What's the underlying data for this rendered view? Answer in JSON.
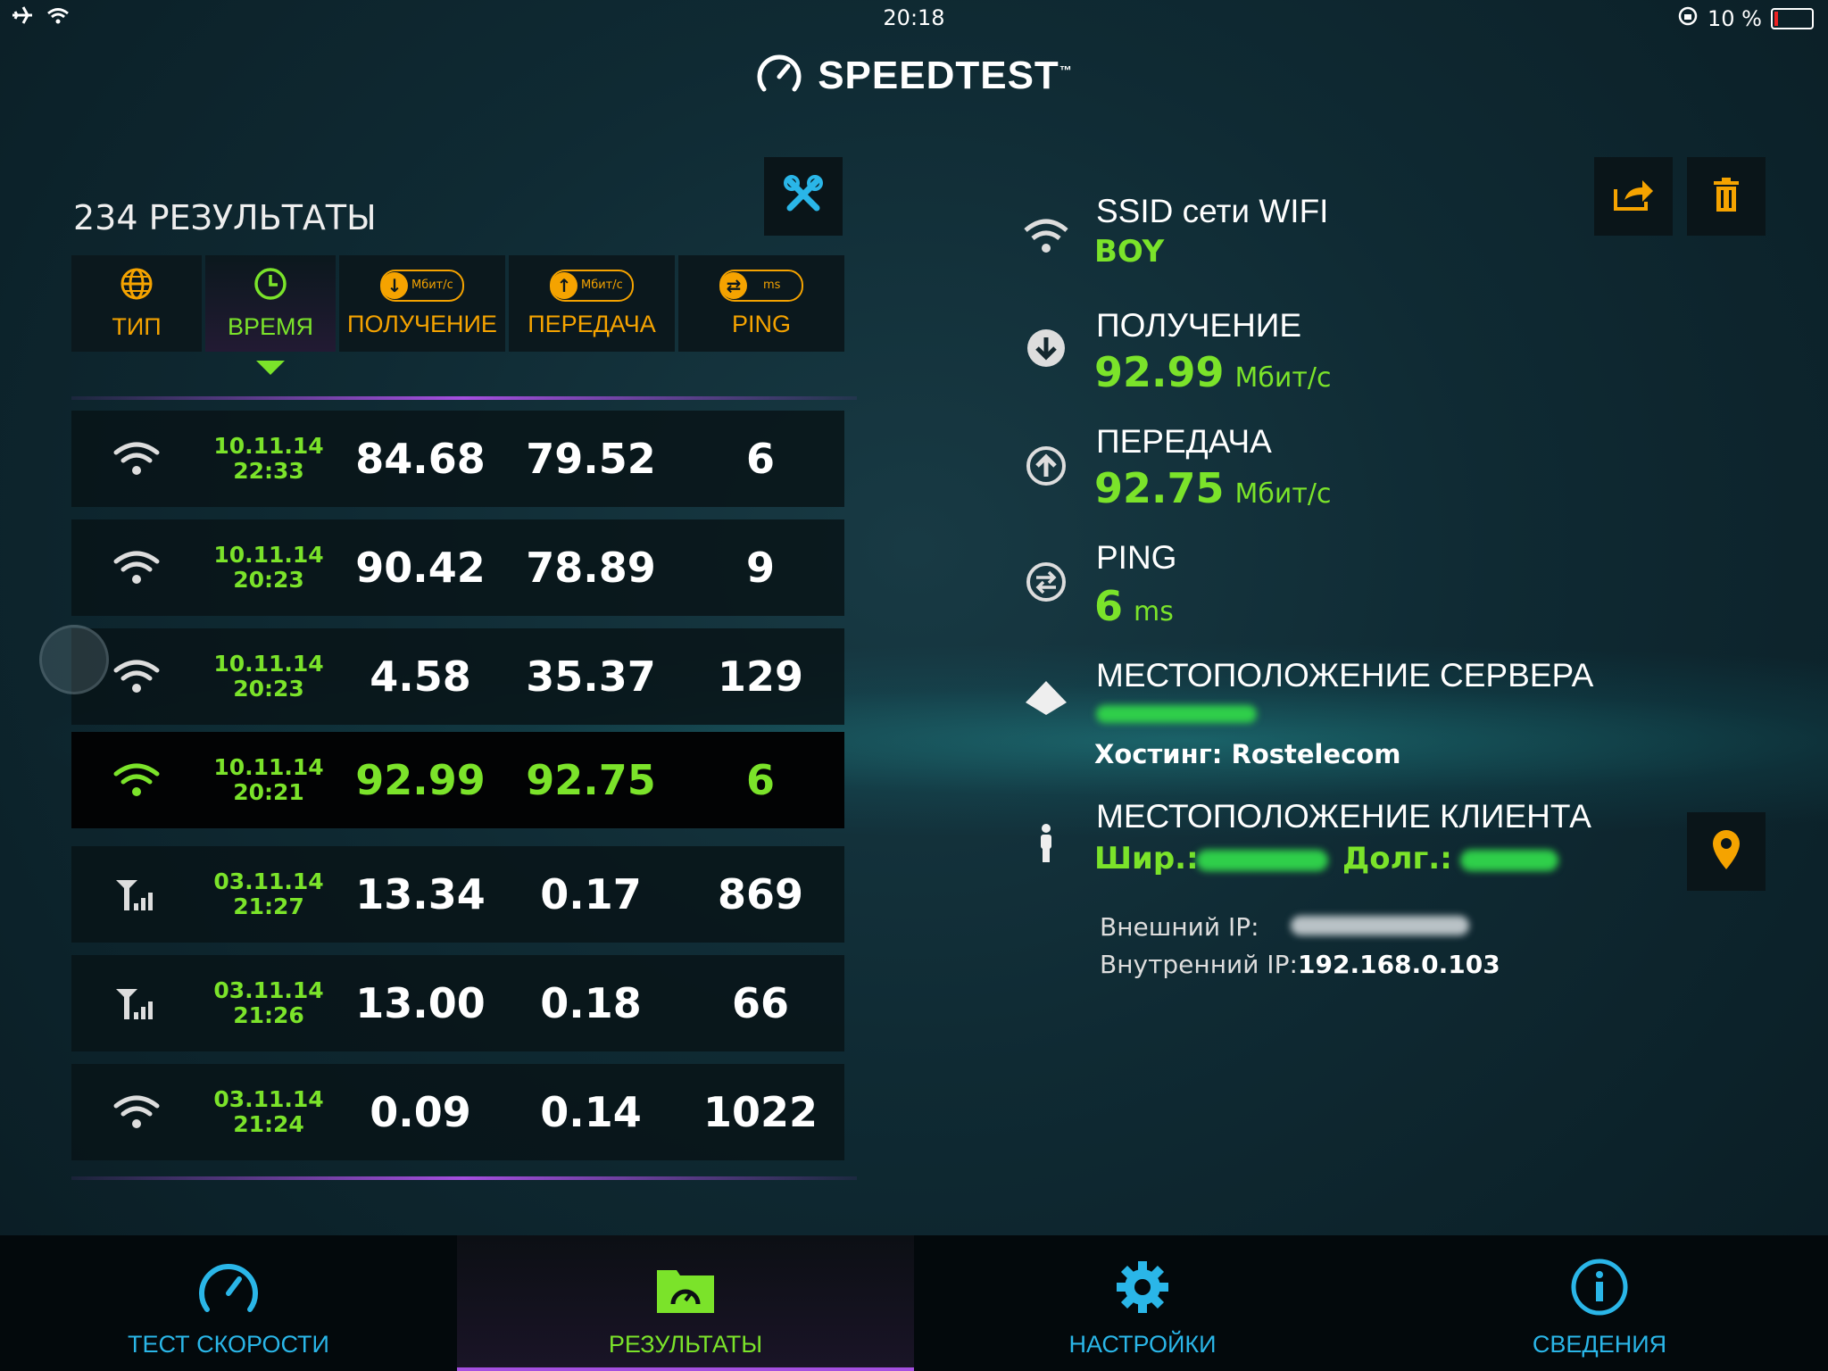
{
  "status_bar": {
    "time": "20:18",
    "battery": "10 %",
    "battery_level": 0.1
  },
  "app": {
    "title": "SPEEDTEST",
    "trademark": "™"
  },
  "results": {
    "count_title": "234 РЕЗУЛЬТАТЫ",
    "columns": [
      {
        "label": "ТИП",
        "icon": "globe-icon"
      },
      {
        "label": "ВРЕМЯ",
        "icon": "clock-icon"
      },
      {
        "label": "ПОЛУЧЕНИЕ",
        "icon": "download-icon",
        "unit": "Мбит/с"
      },
      {
        "label": "ПЕРЕДАЧА",
        "icon": "upload-icon",
        "unit": "Мбит/с"
      },
      {
        "label": "PING",
        "icon": "ping-icon",
        "unit": "ms"
      }
    ],
    "rows": [
      {
        "type": "wifi",
        "date": "10.11.14",
        "time": "22:33",
        "download": "84.68",
        "upload": "79.52",
        "ping": "6"
      },
      {
        "type": "wifi",
        "date": "10.11.14",
        "time": "20:23",
        "download": "90.42",
        "upload": "78.89",
        "ping": "9"
      },
      {
        "type": "wifi",
        "date": "10.11.14",
        "time": "20:23",
        "download": "4.58",
        "upload": "35.37",
        "ping": "129"
      },
      {
        "type": "wifi",
        "date": "10.11.14",
        "time": "20:21",
        "download": "92.99",
        "upload": "92.75",
        "ping": "6"
      },
      {
        "type": "cellular",
        "date": "03.11.14",
        "time": "21:27",
        "download": "13.34",
        "upload": "0.17",
        "ping": "869"
      },
      {
        "type": "cellular",
        "date": "03.11.14",
        "time": "21:26",
        "download": "13.00",
        "upload": "0.18",
        "ping": "66"
      },
      {
        "type": "wifi",
        "date": "03.11.14",
        "time": "21:24",
        "download": "0.09",
        "upload": "0.14",
        "ping": "1022"
      }
    ]
  },
  "detail": {
    "ssid_label": "SSID сети WIFI",
    "ssid_value": "BOY",
    "download_label": "ПОЛУЧЕНИЕ",
    "download_value": "92.99",
    "download_unit": "Мбит/с",
    "upload_label": "ПЕРЕДАЧА",
    "upload_value": "92.75",
    "upload_unit": "Мбит/с",
    "ping_label": "PING",
    "ping_value": "6",
    "ping_unit": "ms",
    "server_label": "МЕСТОПОЛОЖЕНИЕ СЕРВЕРА",
    "hosting_label": "Хостинг:",
    "hosting_value": "Rostelecom",
    "client_label": "МЕСТОПОЛОЖЕНИЕ КЛИЕНТА",
    "lat_label": "Шир.:",
    "lon_label": "Долг.:",
    "external_ip_label": "Внешний IP:",
    "internal_ip_label": "Внутренний IP:",
    "internal_ip_value": "192.168.0.103"
  },
  "tabs": [
    {
      "label": "ТЕСТ СКОРОСТИ",
      "icon": "speedometer-icon"
    },
    {
      "label": "РЕЗУЛЬТАТЫ",
      "icon": "results-folder-icon"
    },
    {
      "label": "НАСТРОЙКИ",
      "icon": "gear-icon"
    },
    {
      "label": "СВЕДЕНИЯ",
      "icon": "info-icon"
    }
  ],
  "colors": {
    "accent_green": "#7be32a",
    "accent_orange": "#f5a300",
    "accent_blue": "#2ab6e8",
    "accent_purple": "#a54fe0"
  }
}
